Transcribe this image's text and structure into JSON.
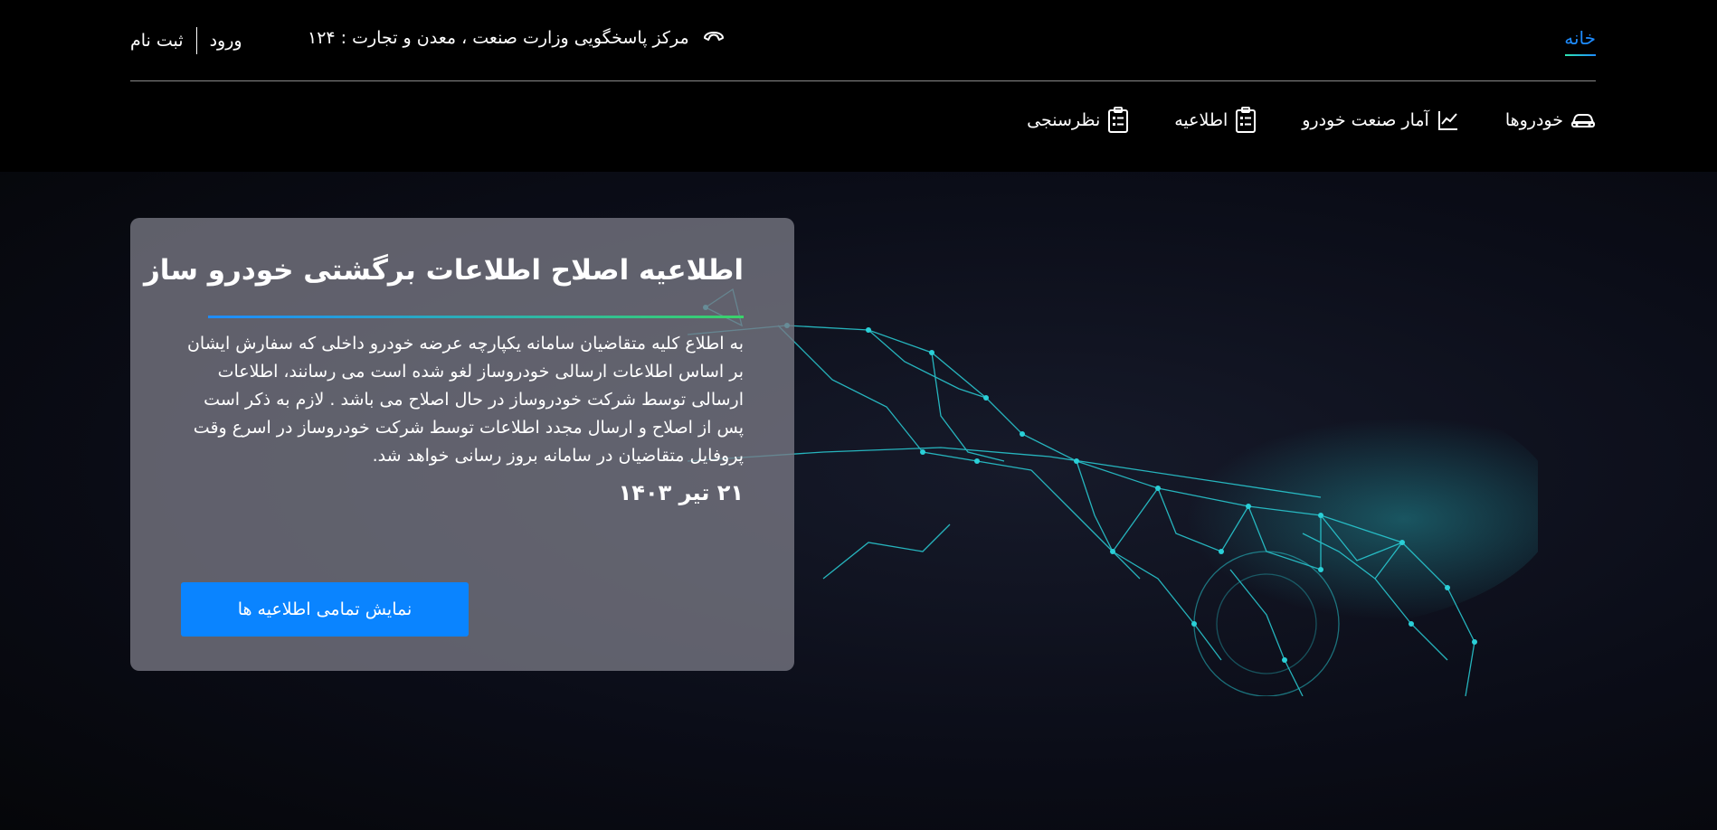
{
  "topbar": {
    "home_label": "خانه",
    "support_text": "مرکز پاسخگویی وزارت صنعت ، معدن و تجارت : ۱۲۴",
    "login_label": "ورود",
    "register_label": "ثبت نام"
  },
  "nav": {
    "items": [
      {
        "label": "خودروها",
        "icon": "car-icon"
      },
      {
        "label": "آمار صنعت خودرو",
        "icon": "chart-icon"
      },
      {
        "label": "اطلاعیه",
        "icon": "clipboard-icon"
      },
      {
        "label": "نظرسنجی",
        "icon": "clipboard-icon"
      }
    ]
  },
  "announcement": {
    "title": "اطلاعیه اصلاح اطلاعات برگشتی خودرو ساز",
    "body": "به اطلاع کلیه متقاضیان سامانه یکپارچه عرضه خودرو داخلی که سفارش ایشان بر اساس اطلاعات ارسالی خودروساز لغو شده است می رسانند، اطلاعات ارسالی توسط شرکت خودروساز در حال اصلاح می باشد . لازم به ذکر است پس از اصلاح و ارسال مجدد اطلاعات توسط شرکت خودروساز در اسرع وقت پروفایل متقاضیان در سامانه بروز رسانی خواهد شد.",
    "date": "۲۱ تیر ۱۴۰۳",
    "button_label": "نمایش تمامی اطلاعیه ها"
  },
  "colors": {
    "accent": "#0a84ff",
    "home_link": "#1e8cff",
    "rule_start": "#1e8cff",
    "rule_end": "#3ad36a",
    "car_wireframe": "#2ad0d8"
  }
}
